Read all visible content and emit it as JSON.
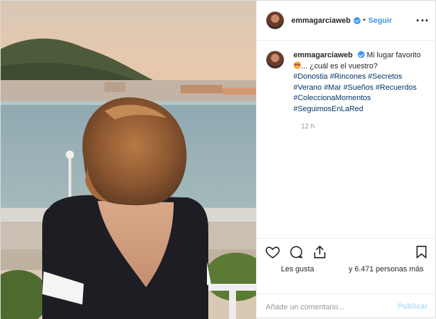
{
  "post": {
    "username": "emmagarciaweb",
    "follow_label": "Seguir",
    "dot_separator": "•",
    "caption": {
      "line1": "Mi lugar favorito",
      "line2": "... ¿cuál es el vuestro?",
      "tags": [
        "#Donostia",
        "#Rincones",
        "#Secretos",
        "#Verano",
        "#Mar",
        "#Sueños",
        "#Recuerdos",
        "#ColeccionaMomentos",
        "#SeguimosEnLaRed"
      ]
    },
    "time_ago": "12 h",
    "likes_label": "Les gusta",
    "likes_count": "y 6.471 personas más",
    "comment_placeholder": "Añade un comentario...",
    "publish_label": "Publicar"
  },
  "icons": {
    "like": "heart-icon",
    "comment": "comment-bubble-icon",
    "share": "share-icon",
    "save": "bookmark-icon",
    "more": "more-options-icon",
    "verified": "verified-badge-icon"
  },
  "colors": {
    "accent": "#3897f0",
    "hashtag": "#003569",
    "muted": "#999999",
    "publish_disabled": "#b2dffc"
  }
}
